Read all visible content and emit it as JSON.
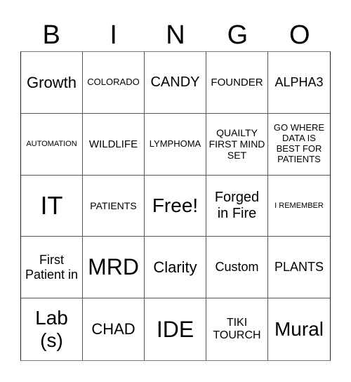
{
  "header": [
    "B",
    "I",
    "N",
    "G",
    "O"
  ],
  "cells": [
    "Growth",
    "COLORADO",
    "CANDY",
    "FOUNDER",
    "ALPHA3",
    "AUTOMATION",
    "WILDLIFE",
    "LYMPHOMA",
    "QUAILTY FIRST MIND SET",
    "GO WHERE DATA IS BEST FOR PATIENTS",
    "IT",
    "PATIENTS",
    "Free!",
    "Forged in Fire",
    "I REMEMBER",
    "First Patient in",
    "MRD",
    "Clarity",
    "Custom",
    "PLANTS",
    "Lab (s)",
    "CHAD",
    "IDE",
    "TIKI TOURCH",
    "Mural"
  ]
}
